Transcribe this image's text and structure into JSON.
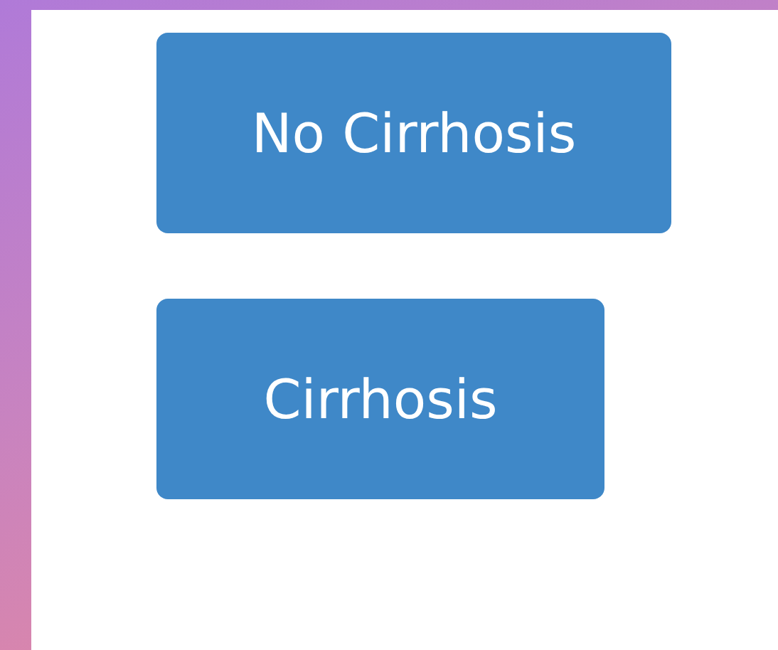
{
  "buttons": [
    {
      "label": "No Cirrhosis"
    },
    {
      "label": "Cirrhosis"
    }
  ]
}
